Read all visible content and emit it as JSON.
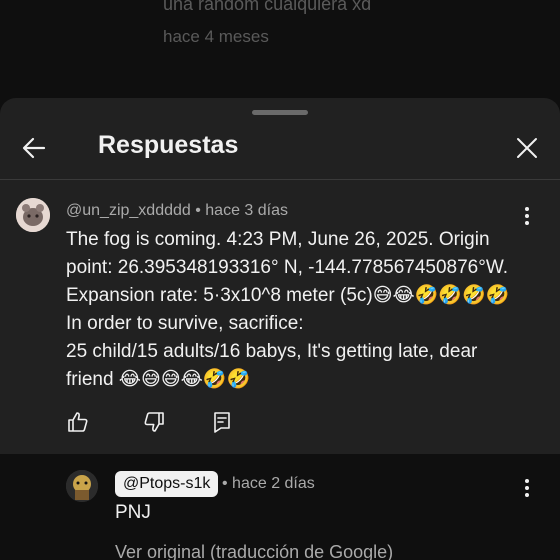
{
  "background": {
    "line1": "una random cualquiera xd",
    "line2": "hace 4 meses"
  },
  "sheet": {
    "title": "Respuestas",
    "back_icon": "arrow-left-icon",
    "close_icon": "close-icon"
  },
  "comment": {
    "author": "@un_zip_xddddd",
    "time": "hace 3 días",
    "lines": [
      "The fog is coming. 4:23 PM, June 26, 2025. Origin",
      "point: 26.395348193316° N, -144.778567450876°W.",
      "Expansion rate: 5·3x10^8 meter (5c)😅😂🤣🤣🤣🤣",
      "In order to survive, sacrifice:",
      "25 child/15 adults/16 babys, It's getting late, dear",
      "friend 😂😅😅😂🤣🤣"
    ],
    "actions": {
      "like_icon": "thumbs-up-icon",
      "dislike_icon": "thumbs-down-icon",
      "reply_icon": "reply-comment-icon"
    }
  },
  "reply": {
    "author": "@Ptops-s1k",
    "time": "hace 2 días",
    "text": "PNJ",
    "translate_link": "Ver original (traducción de Google)"
  },
  "colors": {
    "sheet_bg": "#212121",
    "page_bg": "#0f0f0f",
    "secondary_text": "#aaaaaa",
    "primary_text": "#f1f1f1"
  }
}
